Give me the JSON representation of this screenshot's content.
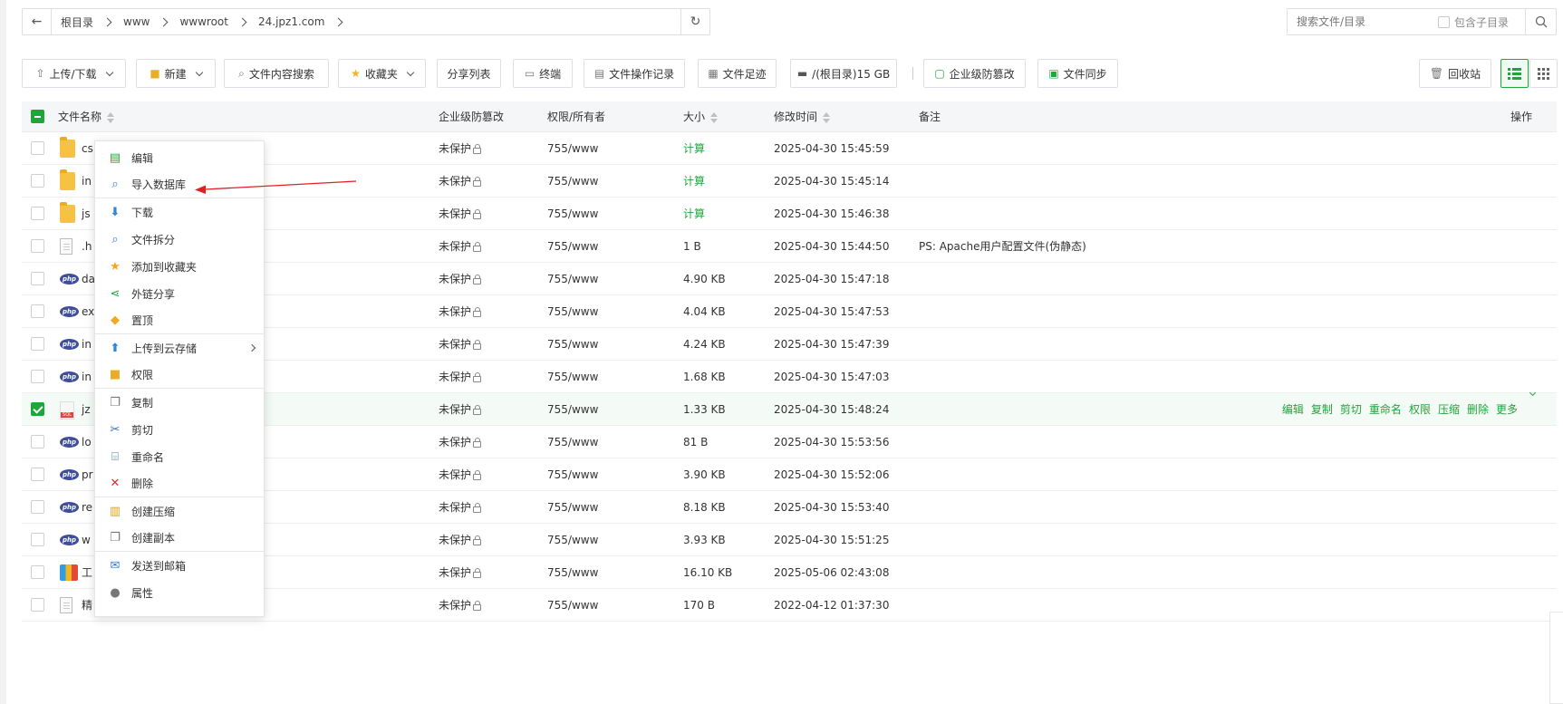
{
  "pathbar": {
    "crumbs": [
      "根目录",
      "www",
      "wwwroot",
      "24.jpz1.com"
    ]
  },
  "search": {
    "placeholder": "搜索文件/目录",
    "include_sub": "包含子目录"
  },
  "toolbar": {
    "upload": "上传/下载",
    "new": "新建",
    "content_search": "文件内容搜索",
    "favorites": "收藏夹",
    "share_list": "分享列表",
    "terminal": "终端",
    "op_log": "文件操作记录",
    "footprint": "文件足迹",
    "disk": "/(根目录)15 GB",
    "tamper": "企业级防篡改",
    "sync": "文件同步",
    "recycle": "回收站"
  },
  "columns": {
    "name": "文件名称",
    "tamper": "企业级防篡改",
    "perm": "权限/所有者",
    "size": "大小",
    "mtime": "修改时间",
    "note": "备注",
    "ops": "操作"
  },
  "rows": [
    {
      "name": "cs",
      "icon": "folder-icon",
      "tamper": "未保护",
      "perm": "755/www",
      "size": "计算",
      "mtime": "2025-04-30 15:45:59",
      "note": ""
    },
    {
      "name": "in",
      "icon": "folder-icon",
      "tamper": "未保护",
      "perm": "755/www",
      "size": "计算",
      "mtime": "2025-04-30 15:45:14",
      "note": ""
    },
    {
      "name": "js",
      "icon": "folder-icon",
      "tamper": "未保护",
      "perm": "755/www",
      "size": "计算",
      "mtime": "2025-04-30 15:46:38",
      "note": ""
    },
    {
      "name": ".h",
      "icon": "doc-icon",
      "tamper": "未保护",
      "perm": "755/www",
      "size": "1 B",
      "mtime": "2025-04-30 15:44:50",
      "note": "PS: Apache用户配置文件(伪静态)"
    },
    {
      "name": "da",
      "icon": "php-icon",
      "tamper": "未保护",
      "perm": "755/www",
      "size": "4.90 KB",
      "mtime": "2025-04-30 15:47:18",
      "note": ""
    },
    {
      "name": "ex",
      "icon": "php-icon",
      "tamper": "未保护",
      "perm": "755/www",
      "size": "4.04 KB",
      "mtime": "2025-04-30 15:47:53",
      "note": ""
    },
    {
      "name": "in",
      "icon": "php-icon",
      "tamper": "未保护",
      "perm": "755/www",
      "size": "4.24 KB",
      "mtime": "2025-04-30 15:47:39",
      "note": ""
    },
    {
      "name": "in",
      "icon": "php-icon",
      "tamper": "未保护",
      "perm": "755/www",
      "size": "1.68 KB",
      "mtime": "2025-04-30 15:47:03",
      "note": ""
    },
    {
      "name": "jz",
      "icon": "sql-icon",
      "tamper": "未保护",
      "perm": "755/www",
      "size": "1.33 KB",
      "mtime": "2025-04-30 15:48:24",
      "note": ""
    },
    {
      "name": "lo",
      "icon": "php-icon",
      "tamper": "未保护",
      "perm": "755/www",
      "size": "81 B",
      "mtime": "2025-04-30 15:53:56",
      "note": ""
    },
    {
      "name": "pr",
      "icon": "php-icon",
      "tamper": "未保护",
      "perm": "755/www",
      "size": "3.90 KB",
      "mtime": "2025-04-30 15:52:06",
      "note": ""
    },
    {
      "name": "re",
      "icon": "php-icon",
      "tamper": "未保护",
      "perm": "755/www",
      "size": "8.18 KB",
      "mtime": "2025-04-30 15:53:40",
      "note": ""
    },
    {
      "name": "w",
      "icon": "php-icon",
      "tamper": "未保护",
      "perm": "755/www",
      "size": "3.93 KB",
      "mtime": "2025-04-30 15:51:25",
      "note": ""
    },
    {
      "name": "工",
      "icon": "zip-icon",
      "tamper": "未保护",
      "perm": "755/www",
      "size": "16.10 KB",
      "mtime": "2025-05-06 02:43:08",
      "note": ""
    },
    {
      "name": "精",
      "icon": "doc-icon",
      "tamper": "未保护",
      "perm": "755/www",
      "size": "170 B",
      "mtime": "2022-04-12 01:37:30",
      "note": ""
    }
  ],
  "selected_row": 8,
  "row_ops": [
    "编辑",
    "复制",
    "剪切",
    "重命名",
    "权限",
    "压缩",
    "删除",
    "更多"
  ],
  "context_menu": [
    {
      "label": "编辑",
      "icon": "edit-icon",
      "sep": false
    },
    {
      "label": "导入数据库",
      "icon": "import-db-icon",
      "sep": true
    },
    {
      "label": "下载",
      "icon": "download-icon",
      "sep": false
    },
    {
      "label": "文件拆分",
      "icon": "split-icon",
      "sep": false
    },
    {
      "label": "添加到收藏夹",
      "icon": "star-icon",
      "sep": false
    },
    {
      "label": "外链分享",
      "icon": "share-icon",
      "sep": false
    },
    {
      "label": "置顶",
      "icon": "pin-icon",
      "sep": true
    },
    {
      "label": "上传到云存储",
      "icon": "upload-cloud-icon",
      "sep": false,
      "submenu": true
    },
    {
      "label": "权限",
      "icon": "permission-icon",
      "sep": true
    },
    {
      "label": "复制",
      "icon": "copy-icon",
      "sep": false
    },
    {
      "label": "剪切",
      "icon": "cut-icon",
      "sep": false
    },
    {
      "label": "重命名",
      "icon": "rename-icon",
      "sep": false
    },
    {
      "label": "删除",
      "icon": "delete-icon",
      "sep": true
    },
    {
      "label": "创建压缩",
      "icon": "compress-icon",
      "sep": false
    },
    {
      "label": "创建副本",
      "icon": "duplicate-icon",
      "sep": true
    },
    {
      "label": "发送到邮箱",
      "icon": "mail-icon",
      "sep": false
    },
    {
      "label": "属性",
      "icon": "info-icon",
      "sep": false
    }
  ],
  "colors": {
    "accent": "#20a53a",
    "annotation": "#e02020"
  }
}
